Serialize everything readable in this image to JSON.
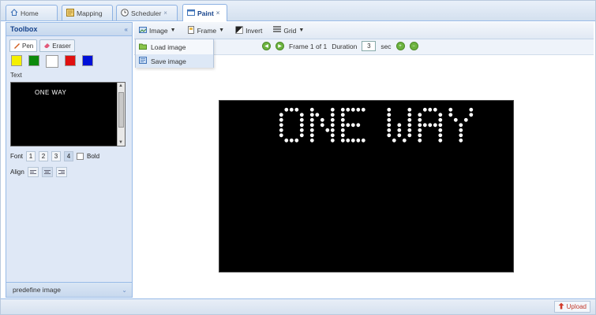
{
  "tabs": [
    {
      "label": "Home",
      "active": false,
      "closable": false
    },
    {
      "label": "Mapping",
      "active": false,
      "closable": false
    },
    {
      "label": "Scheduler",
      "active": false,
      "closable": true
    },
    {
      "label": "Paint",
      "active": true,
      "closable": true
    }
  ],
  "toolbox": {
    "title": "Toolbox",
    "tools": [
      {
        "label": "Pen",
        "icon": "pen-icon",
        "active": true
      },
      {
        "label": "Eraser",
        "icon": "eraser-icon",
        "active": false
      }
    ],
    "colors": [
      "#f5f000",
      "#0d8a0d",
      "#ffffff",
      "#e01010",
      "#0010d8"
    ],
    "text_label": "Text",
    "text_value": "ONE WAY",
    "font_label": "Font",
    "font_sizes": [
      "1",
      "2",
      "3",
      "4"
    ],
    "selected_font": "4",
    "bold_label": "Bold",
    "align_label": "Align",
    "predefined_label": "predefine image"
  },
  "toolbar": {
    "image_label": "Image",
    "frame_label": "Frame",
    "invert_label": "Invert",
    "grid_label": "Grid"
  },
  "image_menu": {
    "load_label": "Load image",
    "save_label": "Save image"
  },
  "frame_bar": {
    "frame_text": "Frame 1 of 1",
    "duration_label": "Duration",
    "duration_value": "3",
    "unit": "sec"
  },
  "canvas": {
    "text": "ONE WAY",
    "background": "#000000",
    "led_color": "#ffffff"
  },
  "status": {
    "upload_label": "Upload"
  }
}
